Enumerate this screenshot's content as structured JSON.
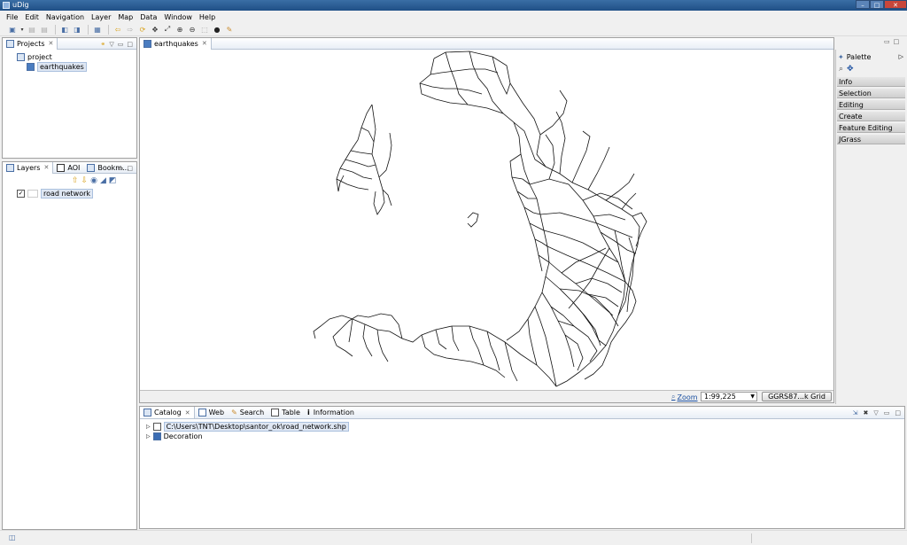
{
  "window": {
    "title": "uDig",
    "buttons": [
      "–",
      "□",
      "✕"
    ]
  },
  "menu": [
    "File",
    "Edit",
    "Navigation",
    "Layer",
    "Map",
    "Data",
    "Window",
    "Help"
  ],
  "projects_view": {
    "tab_label": "Projects",
    "tree": {
      "project": "project",
      "map": "earthquakes"
    }
  },
  "layers_view": {
    "tabs": [
      "Layers",
      "AOI",
      "Bookm..."
    ],
    "layers": [
      {
        "label": "road network",
        "checked": true
      }
    ]
  },
  "map_editor": {
    "tab_label": "earthquakes",
    "zoom_label": "Zoom",
    "scale": "1:99,225",
    "crs_button": "GGRS87...k Grid"
  },
  "palette": {
    "title": "Palette",
    "drawers": [
      "Info",
      "Selection",
      "Editing",
      "Create",
      "Feature Editing",
      "JGrass"
    ]
  },
  "bottom_panel": {
    "tabs": [
      "Catalog",
      "Web",
      "Search",
      "Table",
      "Information"
    ],
    "items": [
      "C:\\Users\\TNT\\Desktop\\santor_ok\\road_network.shp",
      "Decoration"
    ]
  },
  "colors": {
    "selection": "#dfe7f3",
    "titlebar": "#2a5d96",
    "roads": "#111111"
  }
}
